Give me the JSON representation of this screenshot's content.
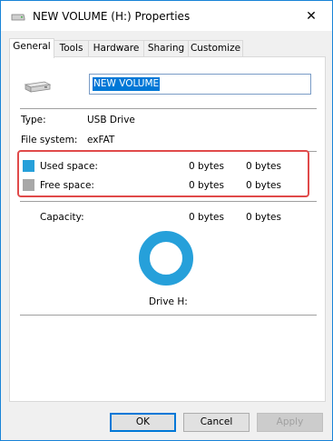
{
  "window": {
    "title": "NEW VOLUME (H:) Properties",
    "close_glyph": "✕"
  },
  "tabs": [
    {
      "label": "General",
      "active": true
    },
    {
      "label": "Tools",
      "active": false
    },
    {
      "label": "Hardware",
      "active": false
    },
    {
      "label": "Sharing",
      "active": false
    },
    {
      "label": "Customize",
      "active": false
    }
  ],
  "general": {
    "volume_name": "NEW VOLUME",
    "type_label": "Type:",
    "type_value": "USB Drive",
    "fs_label": "File system:",
    "fs_value": "exFAT",
    "used_label": "Used space:",
    "used_bytes": "0 bytes",
    "used_size": "0 bytes",
    "free_label": "Free space:",
    "free_bytes": "0 bytes",
    "free_size": "0 bytes",
    "capacity_label": "Capacity:",
    "capacity_bytes": "0 bytes",
    "capacity_size": "0 bytes",
    "drive_label": "Drive H:",
    "used_fraction": 0
  },
  "buttons": {
    "ok": "OK",
    "cancel": "Cancel",
    "apply": "Apply"
  },
  "colors": {
    "used": "#26a0da",
    "free": "#a8a8a8",
    "accent": "#0078d7",
    "highlight_box": "#e04a4a"
  },
  "icons": {
    "title": "usb-drive-icon",
    "close": "close-icon",
    "drive": "usb-drive-icon"
  }
}
